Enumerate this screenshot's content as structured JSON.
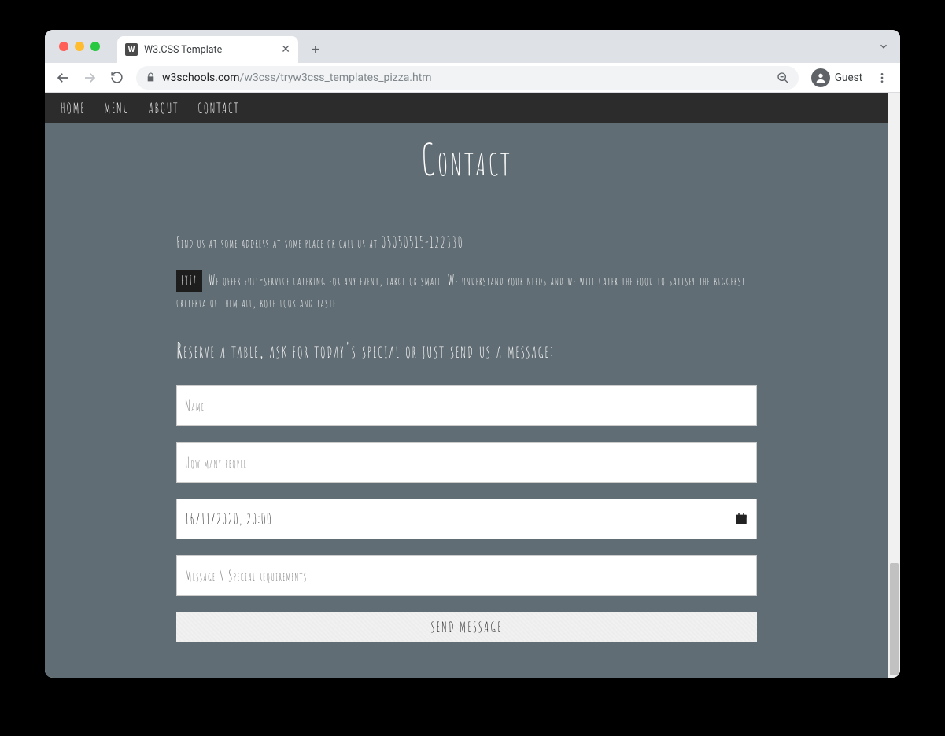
{
  "browser": {
    "tab_title": "W3.CSS Template",
    "url_host": "w3schools.com",
    "url_path": "/w3css/tryw3css_templates_pizza.htm",
    "guest_label": "Guest"
  },
  "nav": {
    "items": [
      "HOME",
      "MENU",
      "ABOUT",
      "CONTACT"
    ]
  },
  "contact": {
    "heading": "Contact",
    "find_us": "Find us at some address at some place or call us at 05050515-122330",
    "fyi_tag": "FYI!",
    "fyi_text": "We offer full-service catering for any event, large or small. We understand your needs and we will cater the food to satisfy the biggerst criteria of them all, both look and taste.",
    "reserve_heading": "Reserve a table, ask for today's special or just send us a message:",
    "form": {
      "name_placeholder": "Name",
      "people_placeholder": "How many people",
      "datetime_value": "16/11/2020, 20:00",
      "message_placeholder": "Message \\ Special requirements",
      "submit_label": "SEND MESSAGE"
    }
  }
}
